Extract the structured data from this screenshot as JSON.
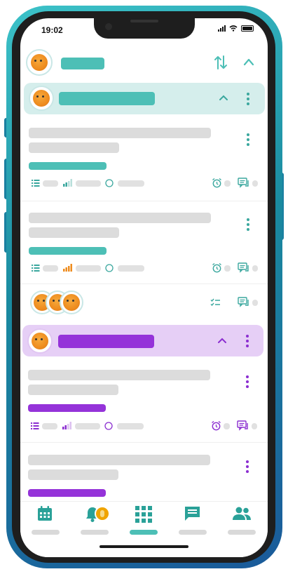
{
  "status_bar": {
    "time": "19:02"
  },
  "colors": {
    "teal": "#4dbfb6",
    "teal_light": "#d5eeec",
    "purple": "#9533d9",
    "purple_light": "#e6cff6",
    "orange": "#ee8c1f",
    "skeleton": "#dcdcdc"
  },
  "header": {
    "icons": [
      "sort-swap-icon",
      "chevron-up-icon"
    ]
  },
  "groups": [
    {
      "accent": "teal",
      "icons": [
        "chevron-up-icon",
        "kebab-icon"
      ]
    },
    {
      "accent": "purple",
      "icons": [
        "chevron-up-icon",
        "kebab-icon"
      ]
    }
  ],
  "priority_levels": {
    "card1": "low",
    "card2": "high",
    "card3": "low"
  },
  "bottom_nav": {
    "items": [
      "calendar-icon",
      "notification-bell-icon",
      "grid-apps-icon",
      "chat-icon",
      "people-icon"
    ],
    "active": "grid-apps-icon"
  }
}
